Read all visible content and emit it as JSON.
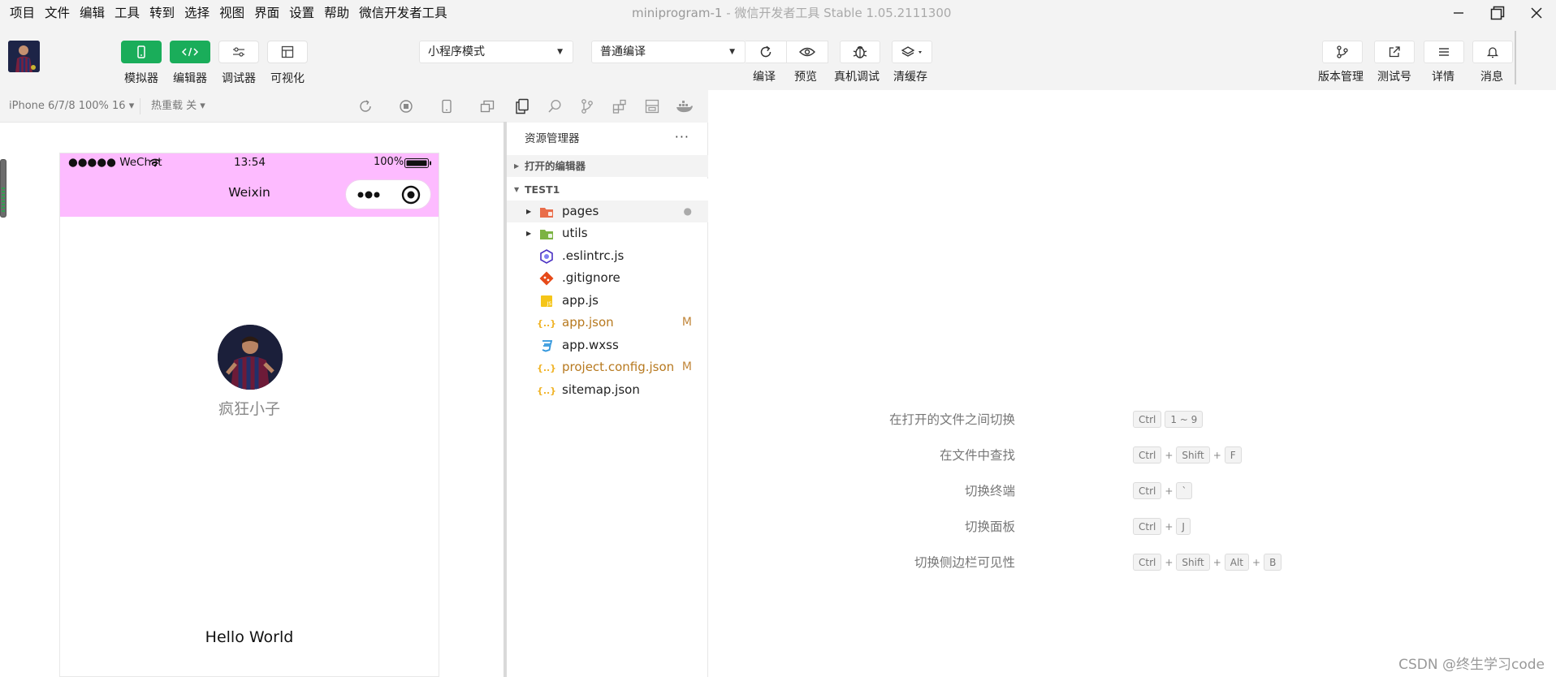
{
  "menubar": {
    "items": [
      "项目",
      "文件",
      "编辑",
      "工具",
      "转到",
      "选择",
      "视图",
      "界面",
      "设置",
      "帮助",
      "微信开发者工具"
    ],
    "title": "miniprogram-1",
    "title_suffix": " - 微信开发者工具 Stable 1.05.2111300"
  },
  "toolbar": {
    "simulator_label": "模拟器",
    "editor_label": "编辑器",
    "debugger_label": "调试器",
    "visual_label": "可视化",
    "mode_select": "小程序模式",
    "compile_select": "普通编译",
    "compile_label": "编译",
    "preview_label": "预览",
    "remote_debug_label": "真机调试",
    "clear_cache_label": "清缓存",
    "version_label": "版本管理",
    "test_account_label": "测试号",
    "details_label": "详情",
    "messages_label": "消息"
  },
  "simulator": {
    "device": "iPhone 6/7/8 100% 16 ▾",
    "hot_reload": "热重载 关 ▾",
    "status": {
      "carrier": "●●●●● WeChat",
      "time": "13:54",
      "battery": "100%"
    },
    "nav_title": "Weixin",
    "nickname": "疯狂小子",
    "hello": "Hello World",
    "colors": {
      "nav_bg": "#fdbbff"
    }
  },
  "explorer": {
    "title": "资源管理器",
    "more": "···",
    "open_editors": "打开的编辑器",
    "project": "TEST1",
    "files": [
      {
        "name": "pages",
        "status": "●"
      },
      {
        "name": "utils",
        "status": ""
      },
      {
        "name": ".eslintrc.js",
        "status": ""
      },
      {
        "name": ".gitignore",
        "status": ""
      },
      {
        "name": "app.js",
        "status": ""
      },
      {
        "name": "app.json",
        "status": "M"
      },
      {
        "name": "app.wxss",
        "status": ""
      },
      {
        "name": "project.config.json",
        "status": "M"
      },
      {
        "name": "sitemap.json",
        "status": ""
      }
    ]
  },
  "editor": {
    "shortcuts": [
      {
        "label": "在打开的文件之间切换",
        "keys": [
          "Ctrl",
          "1 ~ 9"
        ],
        "joined": false
      },
      {
        "label": "在文件中查找",
        "keys": [
          "Ctrl",
          "Shift",
          "F"
        ],
        "joined": true
      },
      {
        "label": "切换终端",
        "keys": [
          "Ctrl",
          "`"
        ],
        "joined": true
      },
      {
        "label": "切换面板",
        "keys": [
          "Ctrl",
          "J"
        ],
        "joined": true
      },
      {
        "label": "切换侧边栏可见性",
        "keys": [
          "Ctrl",
          "Shift",
          "Alt",
          "B"
        ],
        "joined": true
      }
    ],
    "plus": "+",
    "watermark": "CSDN @终生学习code"
  }
}
